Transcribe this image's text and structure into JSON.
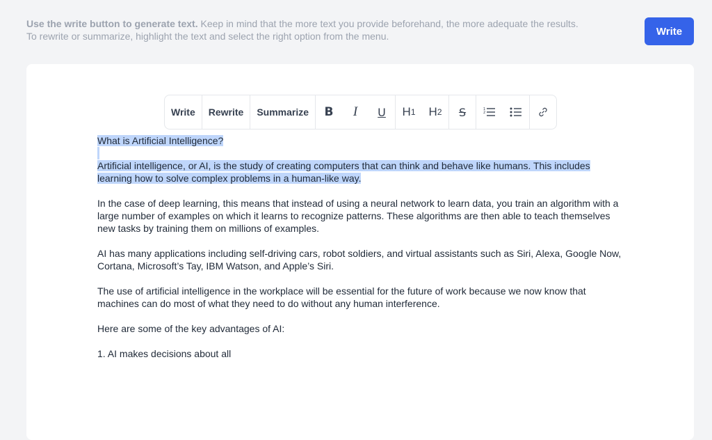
{
  "header": {
    "hint_bold": "Use the write button to generate text.",
    "hint_rest": " Keep in mind that the more text you provide beforehand, the more adequate the results.",
    "hint_line2": "To rewrite or summarize, highlight the text and select the right option from the menu.",
    "write_button": "Write",
    "accent_color": "#3563e9"
  },
  "toolbar": {
    "write": "Write",
    "rewrite": "Rewrite",
    "summarize": "Summarize",
    "bold": "B",
    "italic": "I",
    "underline": "U",
    "h1": "H",
    "h1_sub": "1",
    "h2": "H",
    "h2_sub": "2",
    "strike": "S",
    "icons": [
      "bold-icon",
      "italic-icon",
      "underline-icon",
      "heading1-icon",
      "heading2-icon",
      "strikethrough-icon",
      "ordered-list-icon",
      "bullet-list-icon",
      "link-icon"
    ]
  },
  "editor": {
    "selection_color": "#bfd6fb",
    "paragraphs": [
      "What is Artificial Intelligence?",
      "Artificial intelligence, or AI, is the study of creating computers that can think and behave like humans. This includes learning how to solve complex problems in a human-like way.",
      "In the case of deep learning, this means that instead of using a neural network to learn data, you train an algorithm with a large number of examples on which it learns to recognize patterns. These algorithms are then able to teach themselves new tasks by training them on millions of examples.",
      "AI has many applications including self-driving cars, robot soldiers, and virtual assistants such as Siri, Alexa, Google Now, Cortana, Microsoft’s Tay, IBM Watson, and Apple’s Siri.",
      "The use of artificial intelligence in the workplace will be essential for the future of work because we now know that machines can do most of what they need to do without any human interference.",
      "Here are some of the key advantages of AI:",
      "1. AI makes decisions about all"
    ]
  }
}
